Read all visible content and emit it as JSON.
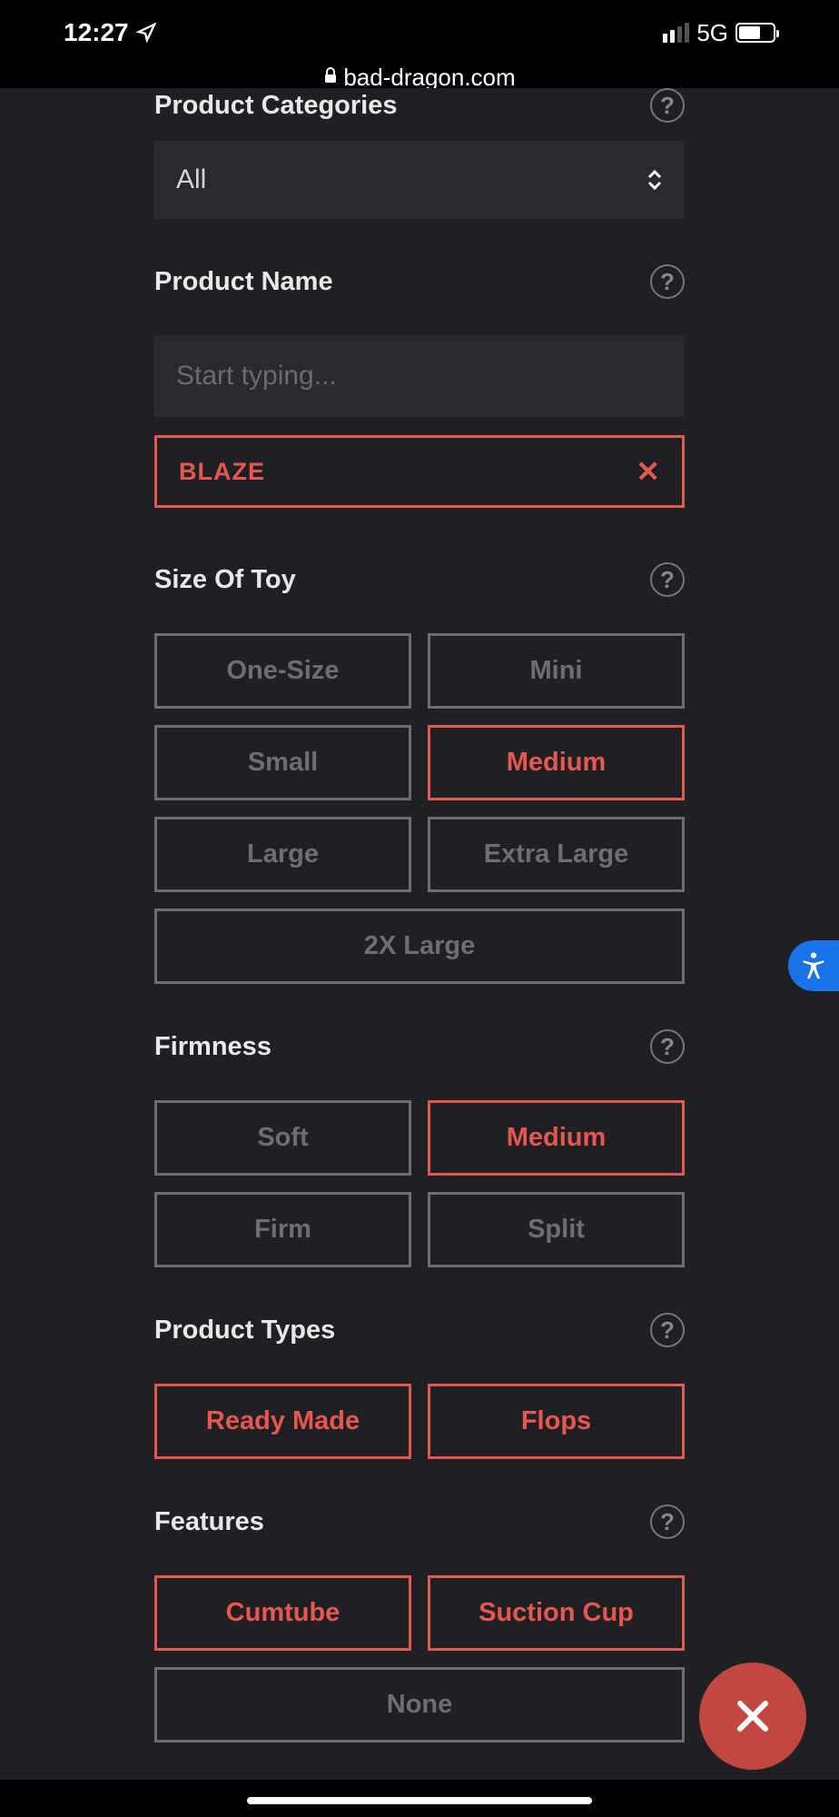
{
  "status_bar": {
    "time": "12:27",
    "network": "5G"
  },
  "url": "bad-dragon.com",
  "sections": {
    "categories": {
      "title": "Product Categories",
      "selected": "All"
    },
    "name": {
      "title": "Product Name",
      "placeholder": "Start typing...",
      "tag": "BLAZE"
    },
    "size": {
      "title": "Size Of Toy",
      "options": [
        "One-Size",
        "Mini",
        "Small",
        "Medium",
        "Large",
        "Extra Large",
        "2X Large"
      ],
      "selected": [
        "Medium"
      ]
    },
    "firmness": {
      "title": "Firmness",
      "options": [
        "Soft",
        "Medium",
        "Firm",
        "Split"
      ],
      "selected": [
        "Medium"
      ]
    },
    "product_types": {
      "title": "Product Types",
      "options": [
        "Ready Made",
        "Flops"
      ],
      "selected": [
        "Ready Made",
        "Flops"
      ]
    },
    "features": {
      "title": "Features",
      "options": [
        "Cumtube",
        "Suction Cup",
        "None"
      ],
      "selected": [
        "Cumtube",
        "Suction Cup"
      ]
    }
  }
}
